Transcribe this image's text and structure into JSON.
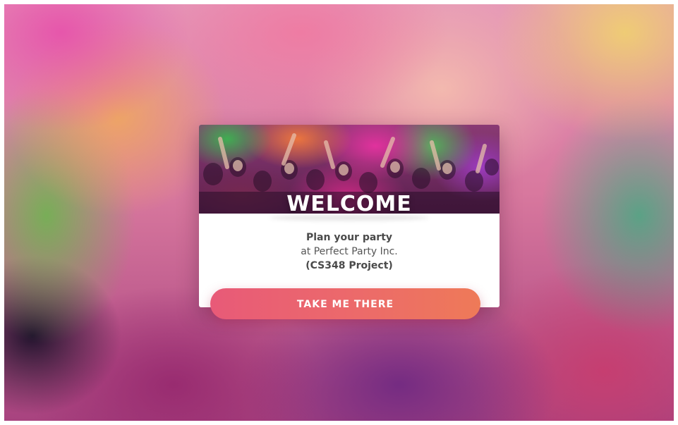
{
  "card": {
    "heading": "WELCOME",
    "line1": "Plan your party",
    "line2": "at Perfect Party Inc.",
    "line3": "(CS348 Project)"
  },
  "cta": {
    "label": "TAKE ME THERE"
  },
  "colors": {
    "cta_start": "#e85a78",
    "cta_end": "#ee7a58",
    "card_background": "#ffffff",
    "text": "#555555"
  }
}
